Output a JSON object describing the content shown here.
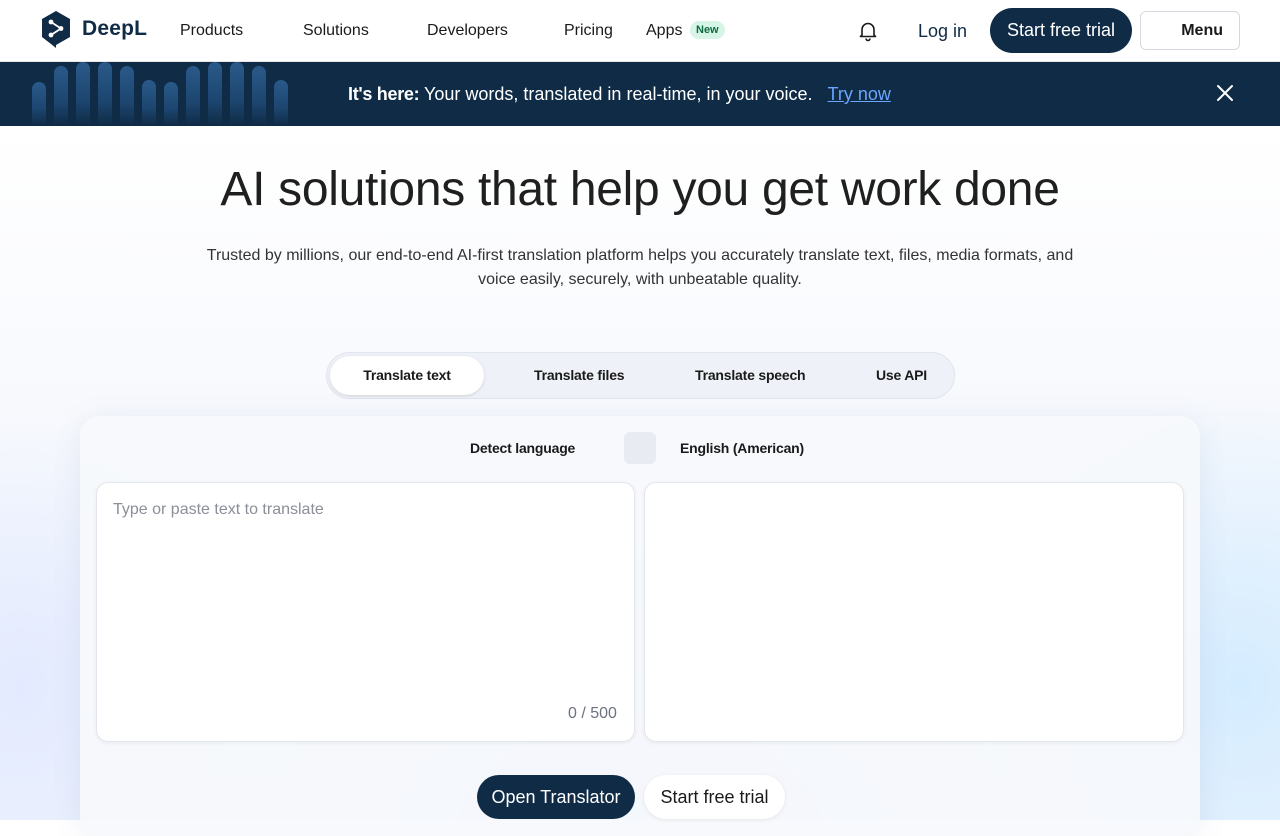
{
  "nav": {
    "brand": "DeepL",
    "links": [
      "Products",
      "Solutions",
      "Developers",
      "Pricing",
      "Apps"
    ],
    "apps_badge": "New",
    "bell_icon": "bell-icon",
    "login": "Log in",
    "cta": "Start free trial",
    "menu": "Menu"
  },
  "banner": {
    "lead": "It's here:",
    "text": "Your words, translated in real-time, in your voice.",
    "link": "Try now",
    "close_icon": "close-icon"
  },
  "hero": {
    "title": "AI solutions that help you get work done",
    "subtitle": "Trusted by millions, our end-to-end AI-first translation platform helps you accurately translate text, files, media formats, and voice easily, securely, with unbeatable quality."
  },
  "tabs": [
    "Translate text",
    "Translate files",
    "Translate speech",
    "Use API"
  ],
  "active_tab": "Translate text",
  "translator": {
    "source_lang": "Detect language",
    "target_lang": "English (American)",
    "swap_icon": "swap-icon",
    "source_placeholder": "Type or paste text to translate",
    "char_count": "0 / 500",
    "open_button": "Open Translator",
    "trial_button": "Start free trial"
  },
  "colors": {
    "brand_navy": "#0f2b46",
    "link_blue": "#6aa7ff",
    "badge_green_bg": "#d6f5e6",
    "badge_green_text": "#0d6b41"
  }
}
